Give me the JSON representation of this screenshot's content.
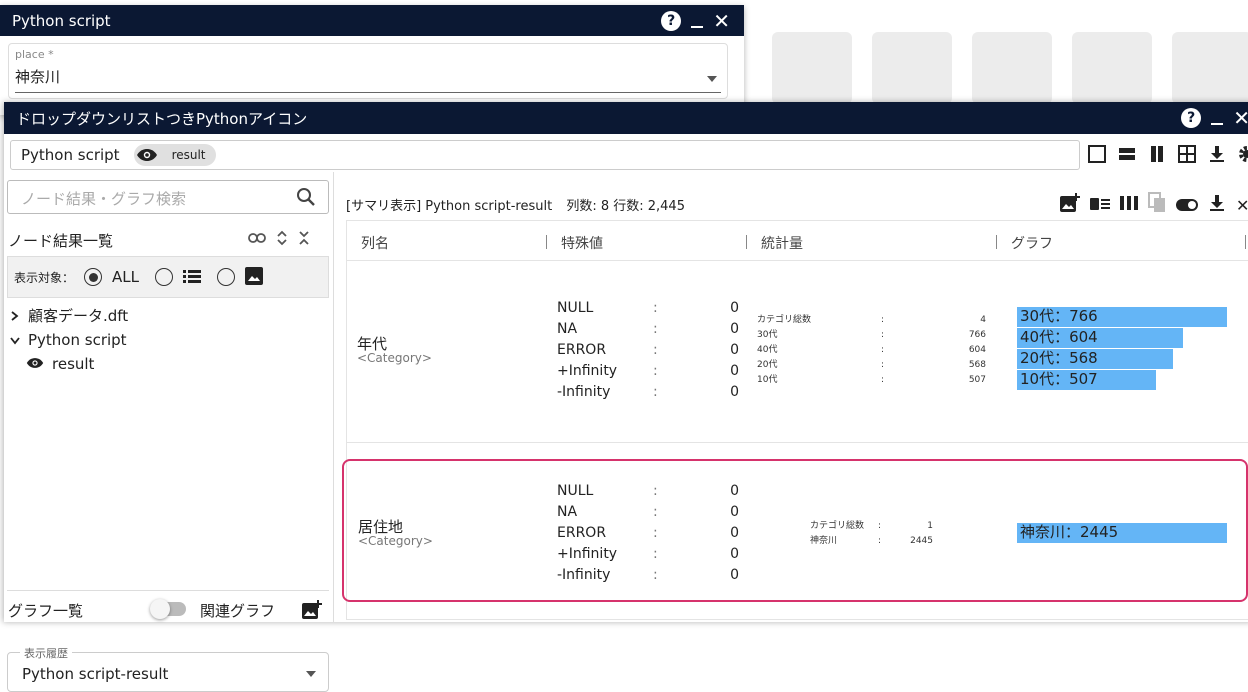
{
  "win1": {
    "title": "Python script",
    "place_label": "place *",
    "place_value": "神奈川"
  },
  "win2": {
    "title": "ドロップダウンリストつきPythonアイコン",
    "path_label": "Python script",
    "chip_label": "result"
  },
  "left": {
    "search_placeholder": "ノード結果・グラフ検索",
    "node_list_title": "ノード結果一覧",
    "filter_label": "表示対象：",
    "filter_all": "ALL",
    "tree": [
      {
        "label": "顧客データ.dft",
        "expanded": false
      },
      {
        "label": "Python script",
        "expanded": true
      },
      {
        "label": "result"
      }
    ],
    "graph_list_title": "グラフ一覧",
    "related_graph": "関連グラフ",
    "history_label": "表示履歴",
    "history_value": "Python script-result"
  },
  "summary": {
    "title": "[サマリ表示] Python script-result",
    "cols_label": "列数: 8",
    "rows_label": "行数: 2,445",
    "headers": [
      "列名",
      "特殊値",
      "統計量",
      "グラフ"
    ],
    "rows": [
      {
        "name": "年代",
        "type": "<Category>",
        "special": [
          {
            "k": "NULL",
            "v": "0"
          },
          {
            "k": "NA",
            "v": "0"
          },
          {
            "k": "ERROR",
            "v": "0"
          },
          {
            "k": "+Infinity",
            "v": "0"
          },
          {
            "k": "-Infinity",
            "v": "0"
          }
        ],
        "stats": [
          {
            "k": "カテゴリ総数",
            "v": "4"
          },
          {
            "k": "30代",
            "v": "766"
          },
          {
            "k": "40代",
            "v": "604"
          },
          {
            "k": "20代",
            "v": "568"
          },
          {
            "k": "10代",
            "v": "507"
          }
        ],
        "bars": [
          {
            "label": "30代：766",
            "value": 766
          },
          {
            "label": "40代：604",
            "value": 604
          },
          {
            "label": "20代：568",
            "value": 568
          },
          {
            "label": "10代：507",
            "value": 507
          }
        ]
      },
      {
        "name": "居住地",
        "type": "<Category>",
        "special": [
          {
            "k": "NULL",
            "v": "0"
          },
          {
            "k": "NA",
            "v": "0"
          },
          {
            "k": "ERROR",
            "v": "0"
          },
          {
            "k": "+Infinity",
            "v": "0"
          },
          {
            "k": "-Infinity",
            "v": "0"
          }
        ],
        "stats": [
          {
            "k": "カテゴリ総数",
            "v": "1"
          },
          {
            "k": "神奈川",
            "v": "2445"
          }
        ],
        "bars": [
          {
            "label": "神奈川：2445",
            "value": 2445
          }
        ]
      }
    ]
  },
  "colors": {
    "titlebar": "#0b1833",
    "bar": "#64b5f6",
    "highlight": "#d6336c"
  }
}
